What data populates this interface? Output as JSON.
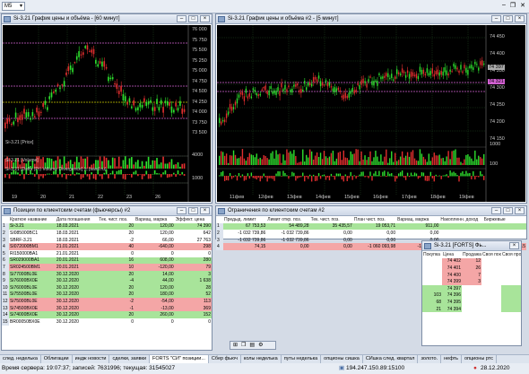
{
  "menu": {
    "selector": "M5"
  },
  "chart1": {
    "title": "Si-3.21 График цены и объёма - [60 минут]",
    "price_label": "Si-3.21 [Price]",
    "volume_label": "Si-3.21 [Volume]",
    "delta_label": "Si-3.21 [Delta (Pr) Volume Divergence] (c pavel.ru)",
    "price_ticks": [
      "76 000",
      "75 750",
      "75 500",
      "75 250",
      "75 000",
      "74 750",
      "74 500",
      "74 250",
      "74 000",
      "73 750",
      "73 500"
    ],
    "volume_tick": "4000",
    "delta_tick": "1000",
    "date_ticks": [
      "19",
      "20",
      "21",
      "22",
      "23",
      "26"
    ]
  },
  "chart2": {
    "title": "Si-3.21 График цены и объёма #2 - [5 минут]",
    "price_ticks": [
      "74 450",
      "74 400",
      "74 350",
      "74 300",
      "74 250",
      "74 200",
      "74 150"
    ],
    "price_current": "74 397",
    "price_highlight": "74 321",
    "volume_tick": "1000",
    "delta_tick": "100",
    "date_ticks": [
      "11фев",
      "12фев",
      "13фев",
      "14фев",
      "15фев",
      "16фев",
      "17фев",
      "18фев",
      "19фев"
    ]
  },
  "positions": {
    "title": "Позиции по клиентским счетам (фьючерсы) #2",
    "columns": [
      "Краткое название",
      "Дата погашения",
      "Тек. чист. поз.",
      "Вариац. маржа",
      "Эффект. цена"
    ],
    "rows": [
      {
        "n": "1",
        "name": "Si-3.21",
        "date": "18.03.2021",
        "pos": "20",
        "margin": "120,00",
        "price": "74 390",
        "hl": "green"
      },
      {
        "n": "2",
        "name": "SI085000BC1",
        "date": "18.03.2021",
        "pos": "20",
        "margin": "120,00",
        "price": "642",
        "hl": ""
      },
      {
        "n": "3",
        "name": "SBRF-3.21",
        "date": "18.03.2021",
        "pos": "-2",
        "margin": "66,00",
        "price": "27 763",
        "hl": ""
      },
      {
        "n": "4",
        "name": "SI072000BM1",
        "date": "21.01.2021",
        "pos": "40",
        "margin": "-640,00",
        "price": "298",
        "hl": "red"
      },
      {
        "n": "5",
        "name": "RI150000BA1",
        "date": "21.01.2021",
        "pos": "0",
        "margin": "0",
        "price": "0",
        "hl": ""
      },
      {
        "n": "6",
        "name": "SR029000BA1",
        "date": "20.01.2021",
        "pos": "16",
        "margin": "608,00",
        "price": "280",
        "hl": "green"
      },
      {
        "n": "7",
        "name": "SR024500BM1",
        "date": "20.01.2021",
        "pos": "10",
        "margin": "-120,00",
        "price": "79",
        "hl": "red"
      },
      {
        "n": "8",
        "name": "Si77000BL0E",
        "date": "30.12.2020",
        "pos": "20",
        "margin": "14,00",
        "price": "3",
        "hl": "green"
      },
      {
        "n": "9",
        "name": "Si76000BX0E",
        "date": "30.12.2020",
        "pos": "-4",
        "margin": "44,00",
        "price": "1 638",
        "hl": "green"
      },
      {
        "n": "10",
        "name": "Si76000BL0E",
        "date": "30.12.2020",
        "pos": "20",
        "margin": "120,00",
        "price": "28",
        "hl": "green"
      },
      {
        "n": "11",
        "name": "Si75500BL0E",
        "date": "30.12.2020",
        "pos": "20",
        "margin": "180,00",
        "price": "52",
        "hl": "green"
      },
      {
        "n": "12",
        "name": "Si75000BL0E",
        "date": "30.12.2020",
        "pos": "-2",
        "margin": "-54,00",
        "price": "113",
        "hl": "red"
      },
      {
        "n": "13",
        "name": "Si74500BX0E",
        "date": "30.12.2020",
        "pos": "-1",
        "margin": "-13,00",
        "price": "369",
        "hl": "red"
      },
      {
        "n": "14",
        "name": "Si74000BX0E",
        "date": "30.12.2020",
        "pos": "20",
        "margin": "260,00",
        "price": "152",
        "hl": "green"
      },
      {
        "n": "15",
        "name": "BR00050BX0E",
        "date": "30.12.2020",
        "pos": "0",
        "margin": "0",
        "price": "0",
        "hl": ""
      }
    ]
  },
  "limits": {
    "title": "Ограничения по клиентским счетам #2",
    "columns": [
      "Предыд. лимит",
      "Лимит откр. поз.",
      "Тек. чист. поз.",
      "План чист. поз.",
      "Вариац. маржа",
      "Накопленн. доход",
      "Биржевые"
    ],
    "rows": [
      {
        "n": "1",
        "c": [
          "67 753,53",
          "54 489,28",
          "35 435,57",
          "19 053,71",
          "911,00",
          "",
          ""
        ],
        "hl": "green"
      },
      {
        "n": "2",
        "c": [
          "-1 032 739,86",
          "-1 032 739,86",
          "0,00",
          "0,00",
          "0,00",
          "",
          ""
        ],
        "hl": ""
      },
      {
        "n": "3",
        "c": [
          "-1 032 739,86",
          "-1 032 739,86",
          "0,00",
          "0,00",
          "0,00",
          "",
          ""
        ],
        "hl": ""
      },
      {
        "n": "4",
        "c": [
          "74,15",
          "0,00",
          "0,00",
          "-1 060 093,98",
          "-13 190,10",
          "",
          "74,15"
        ],
        "hl": "red"
      }
    ]
  },
  "orderbook": {
    "title": "Si-3.21 [FORTS] Фь...",
    "columns": [
      "Покупка",
      "Цена",
      "Продажа",
      "Своя покупка",
      "Своя продажа"
    ],
    "rows": [
      {
        "buy": "",
        "price": "74 402",
        "sell": "12",
        "side": "sell"
      },
      {
        "buy": "",
        "price": "74 401",
        "sell": "26",
        "side": "sell"
      },
      {
        "buy": "",
        "price": "74 400",
        "sell": "7",
        "side": "sell"
      },
      {
        "buy": "",
        "price": "74 399",
        "sell": "3",
        "side": "sell"
      },
      {
        "buy": "",
        "price": "74 397",
        "sell": "",
        "side": "buy"
      },
      {
        "buy": "103",
        "price": "74 396",
        "sell": "",
        "side": "buy"
      },
      {
        "buy": "68",
        "price": "74 395",
        "sell": "",
        "side": "buy"
      },
      {
        "buy": "21",
        "price": "74 394",
        "sell": "",
        "side": "buy"
      }
    ]
  },
  "tabs": [
    "след. неделька",
    "Облигации",
    "индж новости",
    "сделки, заявки",
    "FORTS \"СИ\" позиции...",
    "Сбер фьюч",
    "колы неделька",
    "путы неделька",
    "опционы сишка",
    "СИшка след. квартал",
    "золото.",
    "нефть",
    "опционы ртс"
  ],
  "status": {
    "server_time": "Время сервера: 19:07:37; записей: 7631996; текущая: 31545027",
    "ip": "194.247.150.89:15100",
    "date": "28.12.2020"
  }
}
